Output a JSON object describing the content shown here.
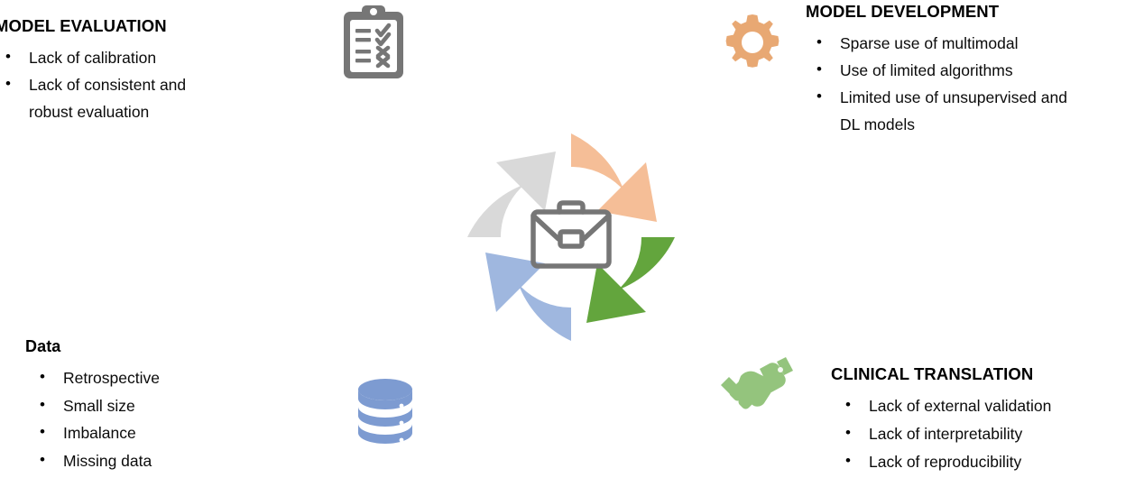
{
  "diagram": {
    "type": "cycle",
    "center_icon": "briefcase-icon",
    "segments": [
      {
        "id": "model-development",
        "color": "#F5BE97",
        "position": "top-right",
        "label": "MODEL DEVELOPMENT"
      },
      {
        "id": "clinical-translation",
        "color": "#63A53D",
        "position": "bottom-right",
        "label": "CLINICAL TRANSLATION"
      },
      {
        "id": "data",
        "color": "#9FB7DF",
        "position": "bottom-left",
        "label": "Data"
      },
      {
        "id": "model-evaluation",
        "color": "#D9D9D9",
        "position": "top-left",
        "label": "MODEL EVALUATION"
      }
    ]
  },
  "colors": {
    "orange": "#F5BE97",
    "green": "#63A53D",
    "blue": "#9FB7DF",
    "gray": "#D9D9D9",
    "icon_gray": "#767676",
    "handshake_green": "#94C47D",
    "database_blue": "#7D9BD1"
  },
  "model_evaluation": {
    "title": "MODEL EVALUATION",
    "bullets": [
      "Lack  of  calibration",
      "Lack  of  consistent  and robust  evaluation"
    ],
    "bullet_lines": [
      [
        "Lack  of  calibration"
      ],
      [
        "Lack  of  consistent  and",
        "robust  evaluation"
      ]
    ]
  },
  "model_development": {
    "title": "MODEL DEVELOPMENT",
    "bullets": [
      "Sparse use of multimodal",
      "Use of limited algorithms",
      "Limited use of unsupervised and DL models"
    ],
    "bullet_lines": [
      [
        "Sparse use of multimodal"
      ],
      [
        "Use of limited algorithms"
      ],
      [
        "Limited use of unsupervised and",
        "DL models"
      ]
    ]
  },
  "data": {
    "title": "Data",
    "bullets": [
      "Retrospective",
      "Small size",
      "Imbalance",
      "Missing data"
    ]
  },
  "clinical_translation": {
    "title": "CLINICAL TRANSLATION",
    "bullets": [
      "Lack of external validation",
      "Lack of interpretability",
      "Lack of reproducibility"
    ]
  },
  "icons": {
    "clipboard": "clipboard-checklist-icon",
    "gear": "gear-icon",
    "database": "database-icon",
    "handshake": "handshake-icon",
    "briefcase": "briefcase-icon"
  }
}
